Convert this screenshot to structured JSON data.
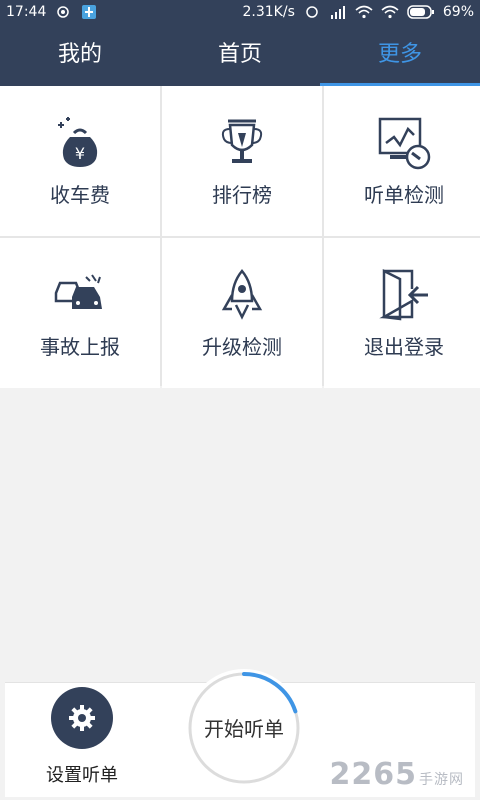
{
  "status_bar": {
    "time": "17:44",
    "speed": "2.31K/s",
    "battery": "69%",
    "icons": [
      "circle-icon",
      "app-icon",
      "nfc-icon",
      "signal-icon",
      "wifi-icon",
      "wifi-icon",
      "battery-icon"
    ]
  },
  "tabs": [
    {
      "label": "我的",
      "active": false
    },
    {
      "label": "首页",
      "active": false
    },
    {
      "label": "更多",
      "active": true
    }
  ],
  "grid": [
    {
      "label": "收车费",
      "icon": "money-bag-icon"
    },
    {
      "label": "排行榜",
      "icon": "trophy-icon"
    },
    {
      "label": "听单检测",
      "icon": "monitor-check-icon"
    },
    {
      "label": "事故上报",
      "icon": "car-accident-icon"
    },
    {
      "label": "升级检测",
      "icon": "rocket-icon"
    },
    {
      "label": "退出登录",
      "icon": "logout-door-icon"
    }
  ],
  "bottom": {
    "settings_label": "设置听单",
    "start_label": "开始听单",
    "progress": 0.2
  },
  "watermark": {
    "text": "2265",
    "suffix": "手游网"
  },
  "colors": {
    "header": "#33415a",
    "accent": "#3f95e5",
    "text": "#2e3b52"
  }
}
